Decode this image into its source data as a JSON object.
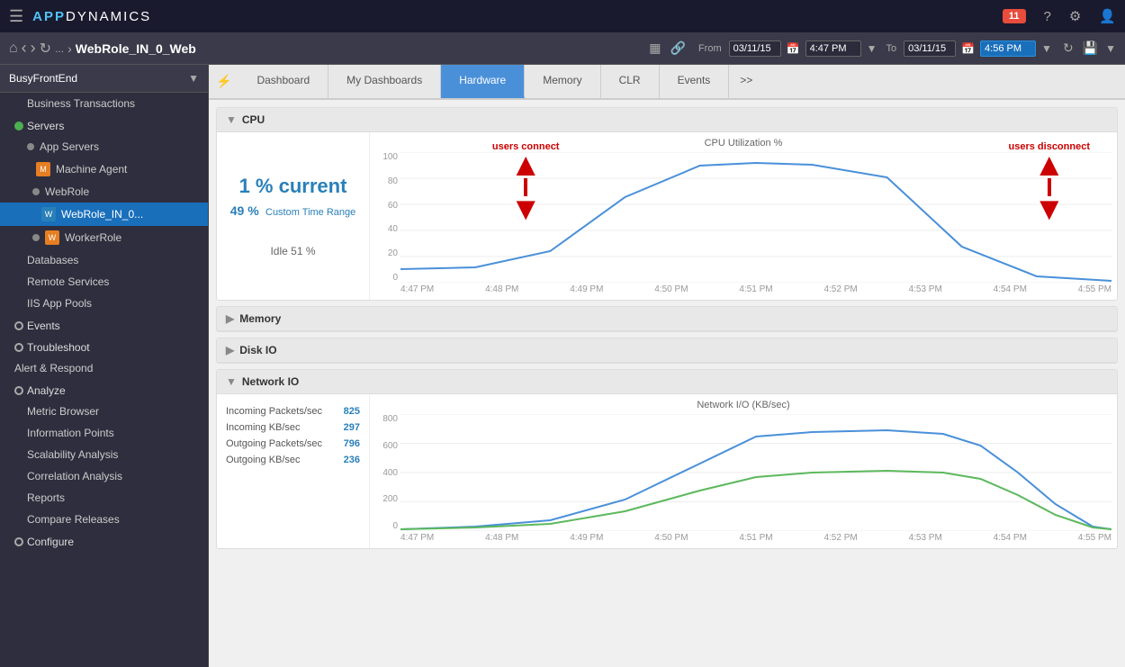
{
  "topbar": {
    "menu_icon": "☰",
    "logo": "APP",
    "logo_name": "DYNAMICS",
    "badge_count": "11",
    "help_icon": "?",
    "settings_icon": "⚙",
    "user_icon": "👤"
  },
  "navbar": {
    "home_icon": "⌂",
    "back_icon": "‹",
    "forward_icon": "›",
    "refresh_icon": "↻",
    "more_icon": "...",
    "chevron_icon": "›",
    "page_title": "WebRole_IN_0_Web",
    "grid_icon": "▦",
    "link_icon": "🔗",
    "from_label": "From",
    "from_date": "03/11/15",
    "from_time": "4:47 PM",
    "to_label": "To",
    "to_date": "03/11/15",
    "to_time": "4:56 PM",
    "refresh_action_icon": "↻",
    "save_icon": "💾",
    "dropdown_icon": "▼"
  },
  "sidebar": {
    "app_name": "BusyFrontEnd",
    "items": [
      {
        "id": "business-transactions",
        "label": "Business Transactions",
        "indent": 1
      },
      {
        "id": "servers",
        "label": "Servers",
        "indent": 0,
        "dot": "green"
      },
      {
        "id": "app-servers",
        "label": "App Servers",
        "indent": 1,
        "dot": "gray"
      },
      {
        "id": "machine-agent",
        "label": "Machine Agent",
        "indent": 2,
        "icon": "M",
        "icon_color": "orange"
      },
      {
        "id": "webrole",
        "label": "WebRole",
        "indent": 2,
        "dot": "gray"
      },
      {
        "id": "webrole-in-0",
        "label": "WebRole_IN_0...",
        "indent": 3,
        "icon": "W",
        "icon_color": "blue",
        "active": true
      },
      {
        "id": "workerrole",
        "label": "WorkerRole",
        "indent": 2,
        "dot": "gray",
        "icon": "W",
        "icon_color": "orange"
      },
      {
        "id": "databases",
        "label": "Databases",
        "indent": 1
      },
      {
        "id": "remote-services",
        "label": "Remote Services",
        "indent": 1
      },
      {
        "id": "iis-app-pools",
        "label": "IIS App Pools",
        "indent": 1
      },
      {
        "id": "events",
        "label": "Events",
        "indent": 0,
        "dot": "gray"
      },
      {
        "id": "troubleshoot",
        "label": "Troubleshoot",
        "indent": 0,
        "dot": "gray"
      },
      {
        "id": "alert-respond",
        "label": "Alert & Respond",
        "indent": 0
      },
      {
        "id": "analyze",
        "label": "Analyze",
        "indent": 0,
        "dot": "gray"
      },
      {
        "id": "metric-browser",
        "label": "Metric Browser",
        "indent": 1
      },
      {
        "id": "information-points",
        "label": "Information Points",
        "indent": 1
      },
      {
        "id": "scalability-analysis",
        "label": "Scalability Analysis",
        "indent": 1
      },
      {
        "id": "correlation-analysis",
        "label": "Correlation Analysis",
        "indent": 1
      },
      {
        "id": "reports",
        "label": "Reports",
        "indent": 1
      },
      {
        "id": "compare-releases",
        "label": "Compare Releases",
        "indent": 1
      },
      {
        "id": "configure",
        "label": "Configure",
        "indent": 0,
        "dot": "gray"
      }
    ]
  },
  "tabs": [
    {
      "id": "dashboard",
      "label": "Dashboard"
    },
    {
      "id": "my-dashboards",
      "label": "My Dashboards"
    },
    {
      "id": "hardware",
      "label": "Hardware",
      "active": true
    },
    {
      "id": "memory",
      "label": "Memory"
    },
    {
      "id": "clr",
      "label": "CLR"
    },
    {
      "id": "events",
      "label": "Events"
    },
    {
      "id": "more",
      "label": ">>"
    }
  ],
  "cpu": {
    "section_title": "CPU",
    "current_value": "1 % current",
    "range_value": "49 %",
    "range_label": "Custom Time Range",
    "idle_label": "Idle 51 %",
    "chart_title": "CPU Utilization %",
    "y_labels": [
      "100",
      "80",
      "60",
      "40",
      "20",
      "0"
    ],
    "x_labels": [
      "4:47 PM",
      "4:48 PM",
      "4:49 PM",
      "4:50 PM",
      "4:51 PM",
      "4:52 PM",
      "4:53 PM",
      "4:54 PM",
      "4:55 PM"
    ]
  },
  "memory": {
    "section_title": "Memory"
  },
  "disk": {
    "section_title": "Disk IO"
  },
  "network": {
    "section_title": "Network  IO",
    "chart_title": "Network I/O (KB/sec)",
    "stats": [
      {
        "label": "Incoming Packets/sec",
        "value": "825"
      },
      {
        "label": "Incoming KB/sec",
        "value": "297"
      },
      {
        "label": "Outgoing Packets/sec",
        "value": "796"
      },
      {
        "label": "Outgoing KB/sec",
        "value": "236"
      }
    ],
    "y_labels": [
      "800",
      "600",
      "400",
      "200",
      "0"
    ],
    "x_labels": [
      "4:47 PM",
      "4:48 PM",
      "4:49 PM",
      "4:50 PM",
      "4:51 PM",
      "4:52 PM",
      "4:53 PM",
      "4:54 PM",
      "4:55 PM"
    ]
  },
  "annotations": {
    "connect_label": "users connect",
    "disconnect_label": "users disconnect"
  },
  "colors": {
    "active_tab": "#4a90d9",
    "cpu_chart_line": "#4a90d9",
    "network_blue": "#4a90d9",
    "network_green": "#5cb85c",
    "arrow_red": "#cc0000",
    "sidebar_active": "#1a6fbb"
  }
}
